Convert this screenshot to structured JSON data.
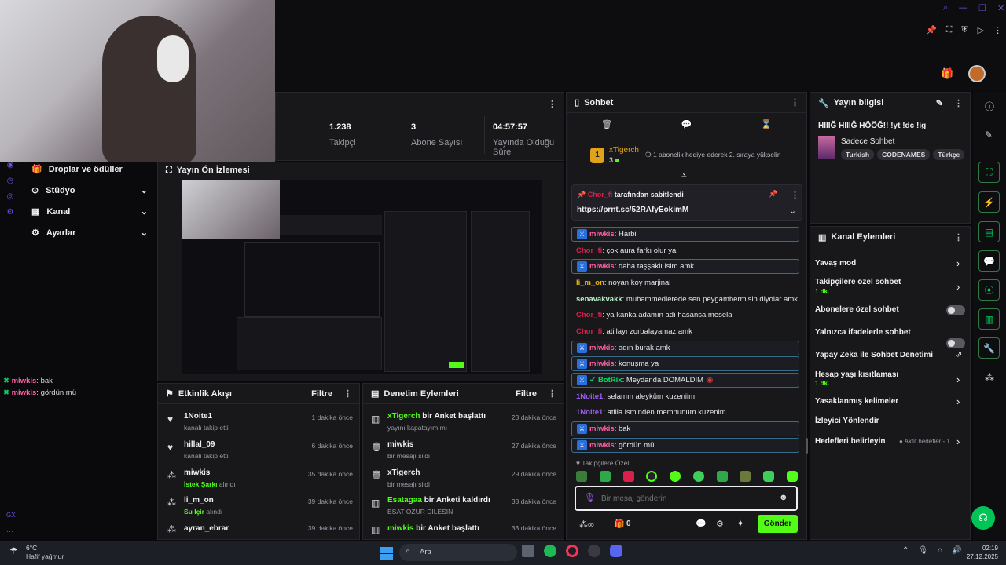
{
  "window": {
    "controls": [
      "search-icon",
      "minimize-icon",
      "restore-icon",
      "close-icon"
    ]
  },
  "stats": [
    {
      "value": "1.238",
      "label": "Takipçi"
    },
    {
      "value": "3",
      "label": "Abone Sayısı"
    },
    {
      "value": "04:57:57",
      "label": "Yayında Olduğu Süre"
    }
  ],
  "sidebar": {
    "items": [
      {
        "label": "Droplar ve ödüller"
      },
      {
        "label": "Stüdyo"
      },
      {
        "label": "Kanal"
      },
      {
        "label": "Ayarlar"
      }
    ]
  },
  "preview": {
    "title": "Yayın Ön İzlemesi"
  },
  "overlay_chat": [
    {
      "user": "miwkis",
      "text": ": bak"
    },
    {
      "user": "miwkis",
      "text": ": gördün mü"
    }
  ],
  "activity": {
    "title": "Etkinlik Akışı",
    "filter": "Filtre",
    "items": [
      {
        "user": "1Noite1",
        "sub": "kanalı takip etti",
        "time": "1 dakika önce",
        "icon": "heart-icon"
      },
      {
        "user": "hillal_09",
        "sub": "kanalı takip etti",
        "time": "6 dakika önce",
        "icon": "heart-icon"
      },
      {
        "user": "miwkis",
        "sub": "İstek Şarkı",
        "sub2": "alındı",
        "time": "35 dakika önce",
        "icon": "points-icon"
      },
      {
        "user": "li_m_on",
        "sub": "Su İçir",
        "sub2": "alındı",
        "time": "39 dakika önce",
        "icon": "points-icon"
      },
      {
        "user": "ayran_ebrar",
        "sub": "",
        "time": "39 dakika önce",
        "icon": "points-icon"
      }
    ]
  },
  "modlog": {
    "title": "Denetim Eylemleri",
    "filter": "Filtre",
    "items": [
      {
        "user": "xTigerch",
        "action": " bir Anket başlattı",
        "sub": "yayını kapatayım mı",
        "time": "23 dakika önce",
        "icon": "poll-icon"
      },
      {
        "user": "miwkis",
        "action": "",
        "sub": "bir mesajı sildi",
        "time": "27 dakika önce",
        "icon": "trash-icon"
      },
      {
        "user": "xTigerch",
        "action": "",
        "sub": "bir mesajı sildi",
        "time": "29 dakika önce",
        "icon": "trash-icon"
      },
      {
        "user": "Esatagaa",
        "action": " bir Anketi kaldırdı",
        "sub": "ESAT ÖZÜR DİLESİN",
        "time": "33 dakika önce",
        "icon": "poll-icon"
      },
      {
        "user": "miwkis",
        "action": " bir Anket başlattı",
        "sub": "",
        "time": "33 dakika önce",
        "icon": "poll-icon"
      }
    ]
  },
  "chat": {
    "title": "Sohbet",
    "gift": {
      "user": "xTigerch",
      "count": "3",
      "text": "1 abonelik hediye ederek 2. sıraya yükselin"
    },
    "pinned": {
      "by": "Chor_fi",
      "by_text": " tarafından sabitlendi",
      "link": "https://prnt.sc/52RAfyEokimM"
    },
    "messages": [
      {
        "user": "miwkis",
        "text": ": Harbi",
        "color": "#ff5fa2",
        "mod": true
      },
      {
        "user": "Chor_fi",
        "text": ": çok aura farkı olur ya",
        "color": "#d9204a",
        "mod": false
      },
      {
        "user": "miwkis",
        "text": ": daha taşşaklı isim amk",
        "color": "#ff5fa2",
        "mod": true
      },
      {
        "user": "li_m_on",
        "text": ": noyan koy marjinal",
        "color": "#e9b600",
        "mod": false
      },
      {
        "user": "senavakvakk",
        "text": ": muhammedlerede sen peygambermisin diyolar amk",
        "color": "#b9f0c8",
        "mod": false
      },
      {
        "user": "Chor_fi",
        "text": ": ya kanka adamın adı hasansa mesela",
        "color": "#d9204a",
        "mod": false
      },
      {
        "user": "Chor_fi",
        "text": ": atillayı zorbalayamaz amk",
        "color": "#d9204a",
        "mod": false
      },
      {
        "user": "miwkis",
        "text": ": adın burak amk",
        "color": "#ff5fa2",
        "mod": true
      },
      {
        "user": "miwkis",
        "text": ": konuşma ya",
        "color": "#ff5fa2",
        "mod": true
      },
      {
        "user": "BotRix",
        "text": ": Meydanda DOMALDIM",
        "color": "#00e05a",
        "mod": true
      },
      {
        "user": "1Noite1",
        "text": ": selamın aleyküm kuzeniim",
        "color": "#9b5cf2",
        "mod": false
      },
      {
        "user": "1Noite1",
        "text": ": atilla isminden memnunum kuzenim",
        "color": "#9b5cf2",
        "mod": false
      },
      {
        "user": "miwkis",
        "text": ": bak",
        "color": "#ff5fa2",
        "mod": true
      },
      {
        "user": "miwkis",
        "text": ": gördün mü",
        "color": "#ff5fa2",
        "mod": true
      }
    ],
    "emote_label": "Takipçilere Özel",
    "input_placeholder": "Bir mesaj gönderin",
    "points": "0",
    "send": "Gönder"
  },
  "stream_info": {
    "title": "Yayın bilgisi",
    "stream_title": "HIIIĞ HIIIĞ HÖÖĞ!! !yt !dc !ig",
    "category": "Sadece Sohbet",
    "tags": [
      "Turkish",
      "CODENAMES",
      "Türkçe"
    ]
  },
  "channel_actions": {
    "title": "Kanal Eylemleri",
    "items": [
      {
        "label": "Yavaş mod",
        "sub": "",
        "type": "chevron"
      },
      {
        "label": "Takipçilere özel sohbet",
        "sub": "1 dk.",
        "type": "chevron"
      },
      {
        "label": "Abonelere özel sohbet",
        "sub": "",
        "type": "toggle"
      },
      {
        "label": "Yalnızca ifadelerle sohbet",
        "sub": "",
        "type": "toggle"
      },
      {
        "label": "Yapay Zeka ile Sohbet Denetimi",
        "sub": "",
        "type": "external"
      },
      {
        "label": "Hesap yaşı kısıtlaması",
        "sub": "1 dk.",
        "type": "chevron"
      },
      {
        "label": "Yasaklanmış kelimeler",
        "sub": "",
        "type": "chevron"
      },
      {
        "label": "İzleyici Yönlendir",
        "sub": "",
        "type": "none"
      },
      {
        "label": "Hedefleri belirleyin",
        "sub": "",
        "type": "goal",
        "extra": "Aktif hedefler - 1"
      }
    ]
  },
  "taskbar": {
    "weather_temp": "6°C",
    "weather_text": "Hafif yağmur",
    "search": "Ara",
    "time": "02:19",
    "date": "27.12.2025"
  },
  "colors": {
    "accent": "#53fc18",
    "bg": "#0a0a0d",
    "panel": "#18181b"
  }
}
